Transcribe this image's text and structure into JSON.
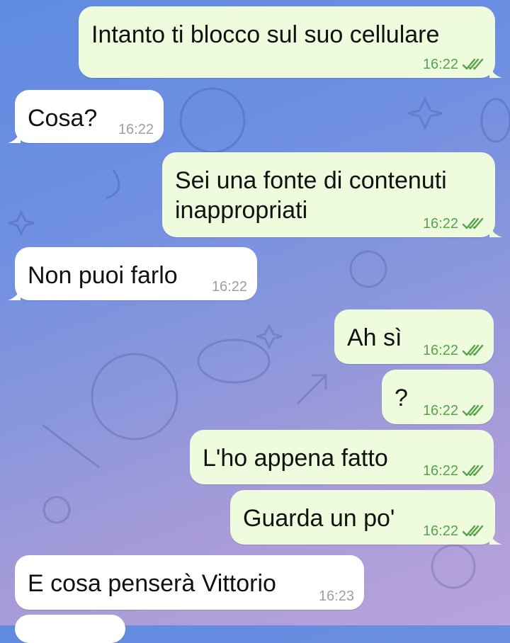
{
  "theme": {
    "outgoing_bg": "#eefbdc",
    "incoming_bg": "#ffffff",
    "check_color": "#55a44c"
  },
  "messages": [
    {
      "dir": "out",
      "text": "Intanto ti blocco sul suo cellulare",
      "time": "16:22",
      "status": "read-double-check-icon"
    },
    {
      "dir": "in",
      "text": "Cosa?",
      "time": "16:22"
    },
    {
      "dir": "out",
      "text_line1": "Sei una fonte di contenuti",
      "text_line2": "inappropriati",
      "time": "16:22",
      "status": "read-double-check-icon"
    },
    {
      "dir": "in",
      "text": "Non puoi farlo",
      "time": "16:22"
    },
    {
      "dir": "out",
      "text": "Ah sì",
      "time": "16:22",
      "status": "read-double-check-icon"
    },
    {
      "dir": "out",
      "text": "?",
      "time": "16:22",
      "status": "read-double-check-icon"
    },
    {
      "dir": "out",
      "text": "L'ho appena fatto",
      "time": "16:22",
      "status": "read-double-check-icon"
    },
    {
      "dir": "out",
      "text": "Guarda un po'",
      "time": "16:22",
      "status": "read-double-check-icon"
    },
    {
      "dir": "in",
      "text": "E cosa penserà Vittorio",
      "time": "16:23"
    }
  ]
}
